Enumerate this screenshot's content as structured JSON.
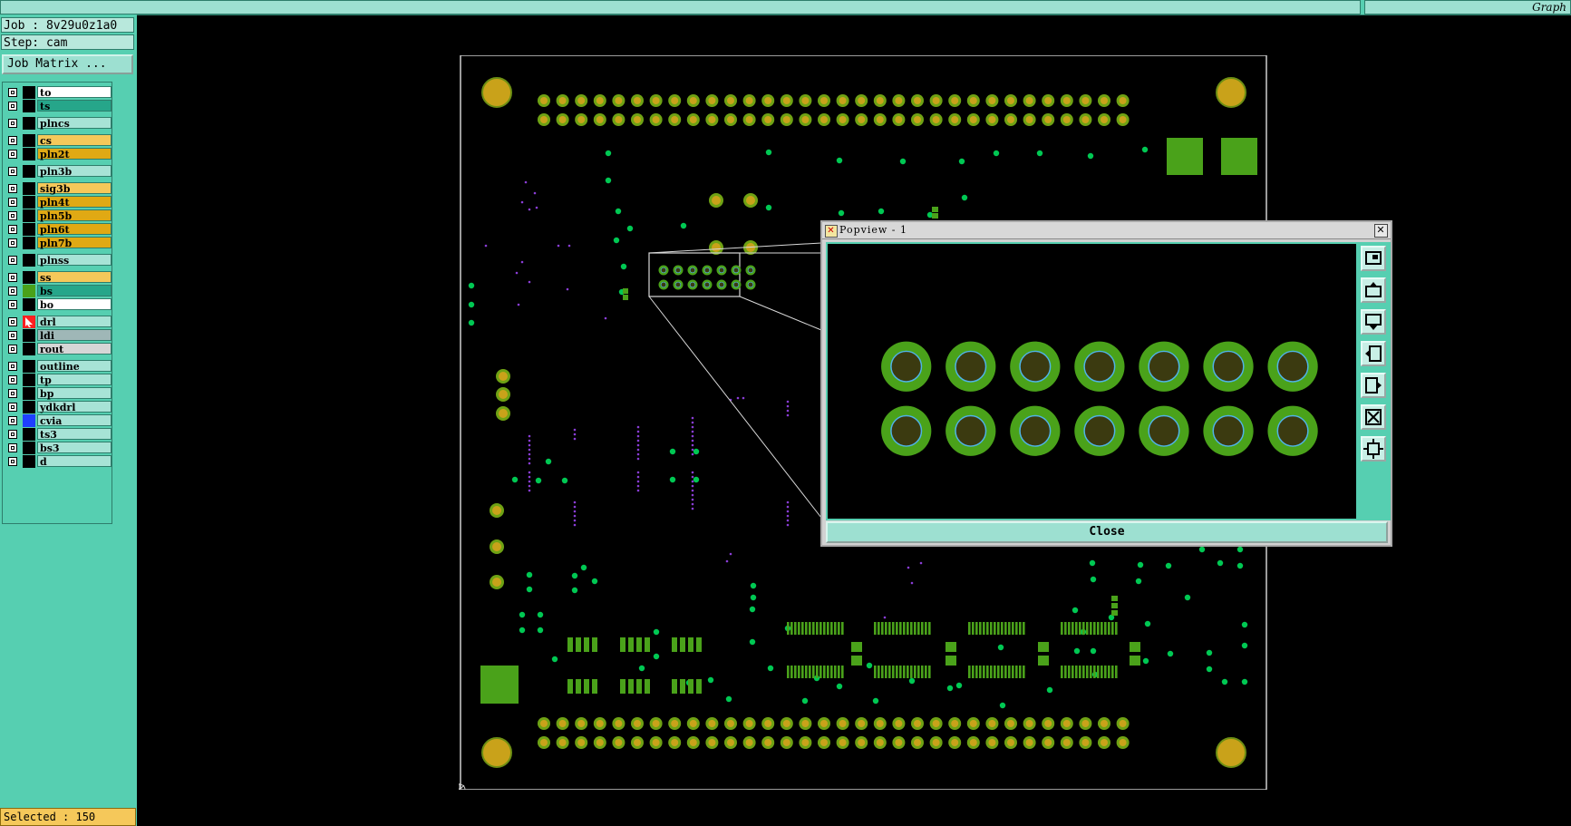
{
  "topbar": {
    "right_label": "Graph"
  },
  "job": {
    "label": "Job : 8v29u0z1a0",
    "step": "Step: cam",
    "matrix_button": "Job Matrix ..."
  },
  "layers": [
    {
      "name": "to",
      "color": "#ffffff",
      "swatch": "#000000"
    },
    {
      "name": "ts",
      "color": "#26a68a",
      "swatch": "#000000"
    },
    {
      "name": "plncs",
      "color": "#a7e3d6",
      "swatch": "#000000"
    },
    {
      "name": "cs",
      "color": "#f5c85a",
      "swatch": "#000000"
    },
    {
      "name": "pln2t",
      "color": "#e0a914",
      "swatch": "#000000"
    },
    {
      "name": "pln3b",
      "color": "#a7e3d6",
      "swatch": "#000000"
    },
    {
      "name": "sig3b",
      "color": "#f5c85a",
      "swatch": "#000000"
    },
    {
      "name": "pln4t",
      "color": "#e0a914",
      "swatch": "#000000"
    },
    {
      "name": "pln5b",
      "color": "#e0a914",
      "swatch": "#000000"
    },
    {
      "name": "pln6t",
      "color": "#e0a914",
      "swatch": "#000000"
    },
    {
      "name": "pln7b",
      "color": "#e0a914",
      "swatch": "#000000"
    },
    {
      "name": "plnss",
      "color": "#a7e3d6",
      "swatch": "#000000"
    },
    {
      "name": "ss",
      "color": "#f5c85a",
      "swatch": "#000000"
    },
    {
      "name": "bs",
      "color": "#26a68a",
      "swatch": "#4aa21a"
    },
    {
      "name": "bo",
      "color": "#ffffff",
      "swatch": "#000000"
    },
    {
      "name": "drl",
      "color": "#a7e3d6",
      "swatch": "#ff2020"
    },
    {
      "name": "ldi",
      "color": "#9fb7b7",
      "swatch": "#000000"
    },
    {
      "name": "rout",
      "color": "#d6d6d6",
      "swatch": "#000000"
    },
    {
      "name": "outline",
      "color": "#a7e3d6",
      "swatch": "#000000"
    },
    {
      "name": "tp",
      "color": "#a7e3d6",
      "swatch": "#000000"
    },
    {
      "name": "bp",
      "color": "#a7e3d6",
      "swatch": "#000000"
    },
    {
      "name": "ydkdrl",
      "color": "#a7e3d6",
      "swatch": "#000000"
    },
    {
      "name": "cvia",
      "color": "#a7e3d6",
      "swatch": "#1f3fff"
    },
    {
      "name": "ts3",
      "color": "#a7e3d6",
      "swatch": "#000000"
    },
    {
      "name": "bs3",
      "color": "#a7e3d6",
      "swatch": "#000000"
    },
    {
      "name": "d",
      "color": "#a7e3d6",
      "swatch": "#000000"
    }
  ],
  "status": {
    "selected": "Selected : 150"
  },
  "popview": {
    "title": "Popview - 1",
    "close_label": "Close",
    "pads_per_row": 7,
    "rows": 2
  },
  "colors": {
    "pad_green": "#4aa21a",
    "pad_ring": "#7fc22a",
    "pad_center": "#3b3a10",
    "drill_blue": "#4fb3e8",
    "gold": "#c9a21a",
    "via": "#00c853",
    "purple": "#8a3dd6",
    "accent_teal": "#56cfb1"
  },
  "icons": [
    "maximize-icon",
    "move-up-icon",
    "move-down-icon",
    "move-left-icon",
    "move-right-icon",
    "zoom-fit-icon",
    "zoom-expand-icon"
  ]
}
